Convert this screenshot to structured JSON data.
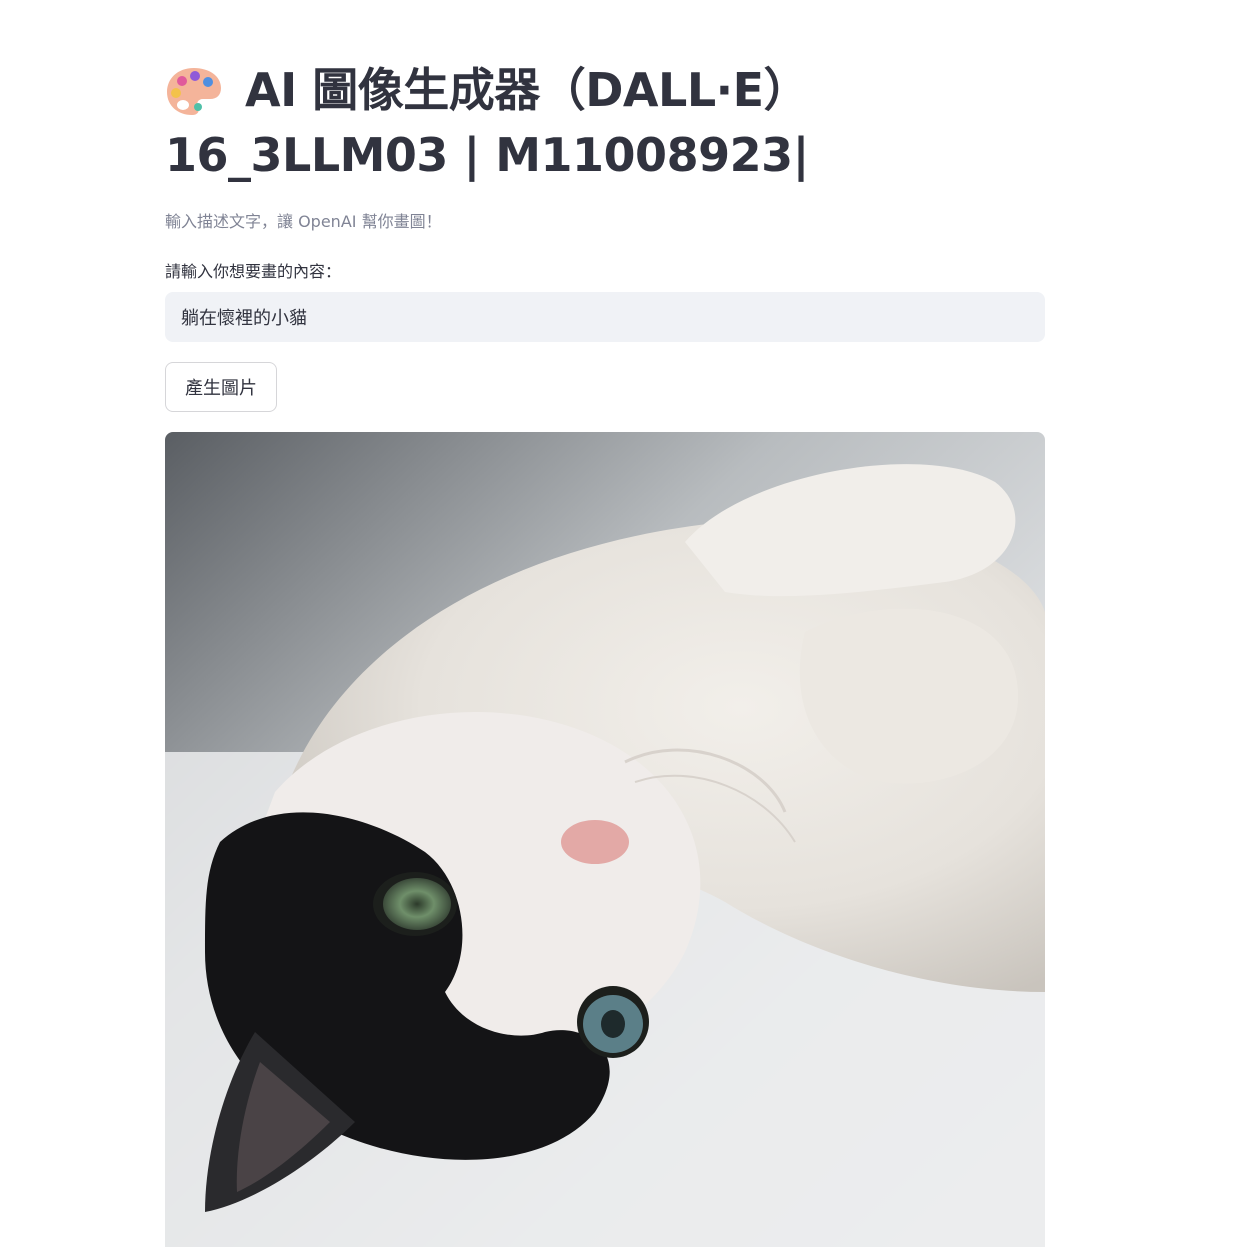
{
  "header": {
    "title_line1": "AI 圖像生成器（DALL·E）",
    "title_line2": "16_3LLM03 | M11008923|",
    "title_icon": "artist-palette-icon",
    "caption": "輸入描述文字，讓 OpenAI 幫你畫圖！"
  },
  "form": {
    "prompt_label": "請輸入你想要畫的內容：",
    "prompt_value": "躺在懷裡的小貓",
    "generate_label": "產生圖片"
  },
  "result": {
    "image_subject": "generated-cat-image"
  },
  "colors": {
    "text": "#31333f",
    "caption": "#808495",
    "input_bg": "#f0f2f6",
    "button_border": "#d6d6d9"
  }
}
